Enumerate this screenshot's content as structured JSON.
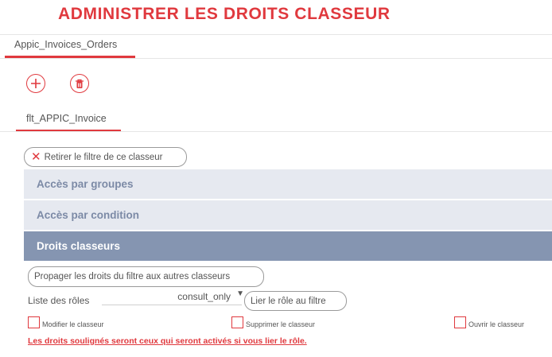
{
  "page": {
    "title": "ADMINISTRER LES DROITS CLASSEUR"
  },
  "tabs": {
    "workbook": "Appic_Invoices_Orders",
    "filter": "flt_APPIC_Invoice"
  },
  "toolbar": {
    "add_icon": "plus-icon",
    "delete_icon": "trash-icon"
  },
  "filter_actions": {
    "remove_filter_label": "Retirer le filtre de ce classeur"
  },
  "accordion": {
    "groups_label": "Accès par groupes",
    "condition_label": "Accès par condition",
    "rights_label": "Droits classeurs"
  },
  "rights": {
    "propagate_label": "Propager les droits du filtre aux autres classeurs",
    "roles_label": "Liste des rôles",
    "roles_selected": "consult_only",
    "link_role_label": "Lier le rôle au filtre",
    "checkboxes": {
      "modify": "Modifier le classeur",
      "delete": "Supprimer le classeur",
      "open": "Ouvrir le classeur"
    },
    "note": "Les droits soulignés seront ceux qui seront activés si vous lier le rôle."
  },
  "colors": {
    "accent": "#e0393e",
    "accordion_bg": "#e6e9f0",
    "accordion_active": "#8595b1"
  }
}
